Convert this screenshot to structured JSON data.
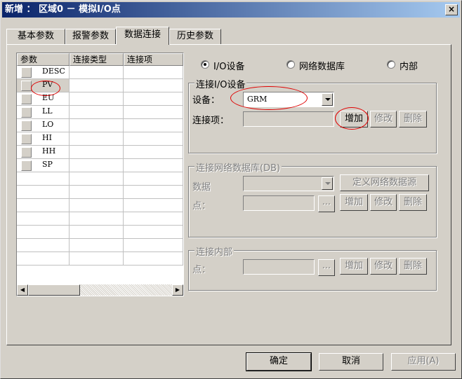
{
  "window": {
    "title": "新增 ： 区域0 － 模拟I/O点",
    "close": "×"
  },
  "tabs": [
    "基本参数",
    "报警参数",
    "数据连接",
    "历史参数"
  ],
  "list": {
    "columns": [
      "参数",
      "连接类型",
      "连接项"
    ],
    "rows": [
      "DESC",
      "PV",
      "EU",
      "LL",
      "LO",
      "HI",
      "HH",
      "SP"
    ]
  },
  "radios": [
    "I/O设备",
    "网络数据库",
    "内部"
  ],
  "io_group": {
    "title": "连接I/O设备",
    "device_label": "设备：",
    "device_value": "GRM",
    "item_label": "连接项：",
    "add": "增加",
    "modify": "修改",
    "delete": "删除"
  },
  "db_group": {
    "title": "连接网络数据库(DB)",
    "data_label": "数据",
    "point_label": "点：",
    "define_btn": "定义网络数据源",
    "browse": "...",
    "add": "增加",
    "modify": "修改",
    "delete": "删除"
  },
  "internal_group": {
    "title": "连接内部",
    "point_label": "点：",
    "browse": "...",
    "add": "增加",
    "modify": "修改",
    "delete": "删除"
  },
  "footer": {
    "ok": "确定",
    "cancel": "取消",
    "apply": "应用(A)"
  }
}
